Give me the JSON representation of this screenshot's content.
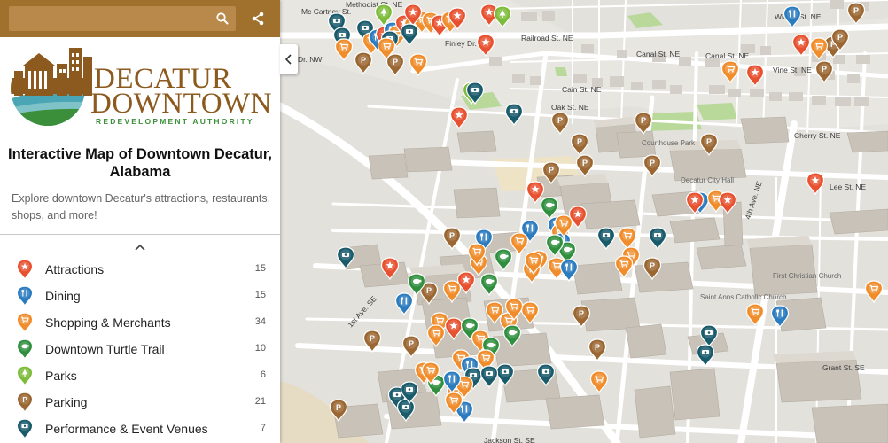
{
  "search": {
    "placeholder": "",
    "value": ""
  },
  "icons": {
    "search": "search-icon",
    "share": "share-icon",
    "collapse": "chevron-left-icon",
    "expand_legend": "chevron-up-icon"
  },
  "logo": {
    "line1": "DECATUR",
    "line2": "DOWNTOWN",
    "tagline": "REDEVELOPMENT AUTHORITY",
    "colors": {
      "brown": "#8c5a1e",
      "green": "#3c8f3a",
      "teal": "#4aa6b4"
    }
  },
  "title": "Interactive Map of Downtown Decatur, Alabama",
  "description": "Explore downtown Decatur's attractions, restaurants, shops, and more!",
  "legend": [
    {
      "label": "Attractions",
      "count": "15",
      "color": "#e8512f",
      "icon": "star-icon"
    },
    {
      "label": "Dining",
      "count": "15",
      "color": "#2b7bbf",
      "icon": "fork-knife-icon"
    },
    {
      "label": "Shopping & Merchants",
      "count": "34",
      "color": "#f08c2a",
      "icon": "shopping-cart-icon"
    },
    {
      "label": "Downtown Turtle Trail",
      "count": "10",
      "color": "#2f8f3e",
      "icon": "turtle-icon"
    },
    {
      "label": "Parks",
      "count": "6",
      "color": "#7dbb3a",
      "icon": "tree-icon"
    },
    {
      "label": "Parking",
      "count": "21",
      "color": "#9a6631",
      "icon": "parking-icon"
    },
    {
      "label": "Performance & Event Venues",
      "count": "7",
      "color": "#195a6b",
      "icon": "ticket-icon"
    }
  ],
  "map": {
    "streets": [
      "Mc Cartney St.",
      "Methodist Ct. NE",
      "Finley Dr. NW",
      "Railroad St. NE",
      "Dr. NW",
      "Canal St. NE",
      "Canal St. NE",
      "Wilson St. NE",
      "Vine St. NE",
      "Oak St. NE",
      "Cain St. NE",
      "Cherry St. NE",
      "Lee St. NE",
      "4th Ave. NE",
      "1st Ave. SE",
      "Grant St. SE",
      "Jackson St. SE"
    ],
    "places": [
      "Courthouse Park",
      "Decatur City Hall",
      "Saint Anns Catholic Church",
      "First Christian Church"
    ]
  }
}
